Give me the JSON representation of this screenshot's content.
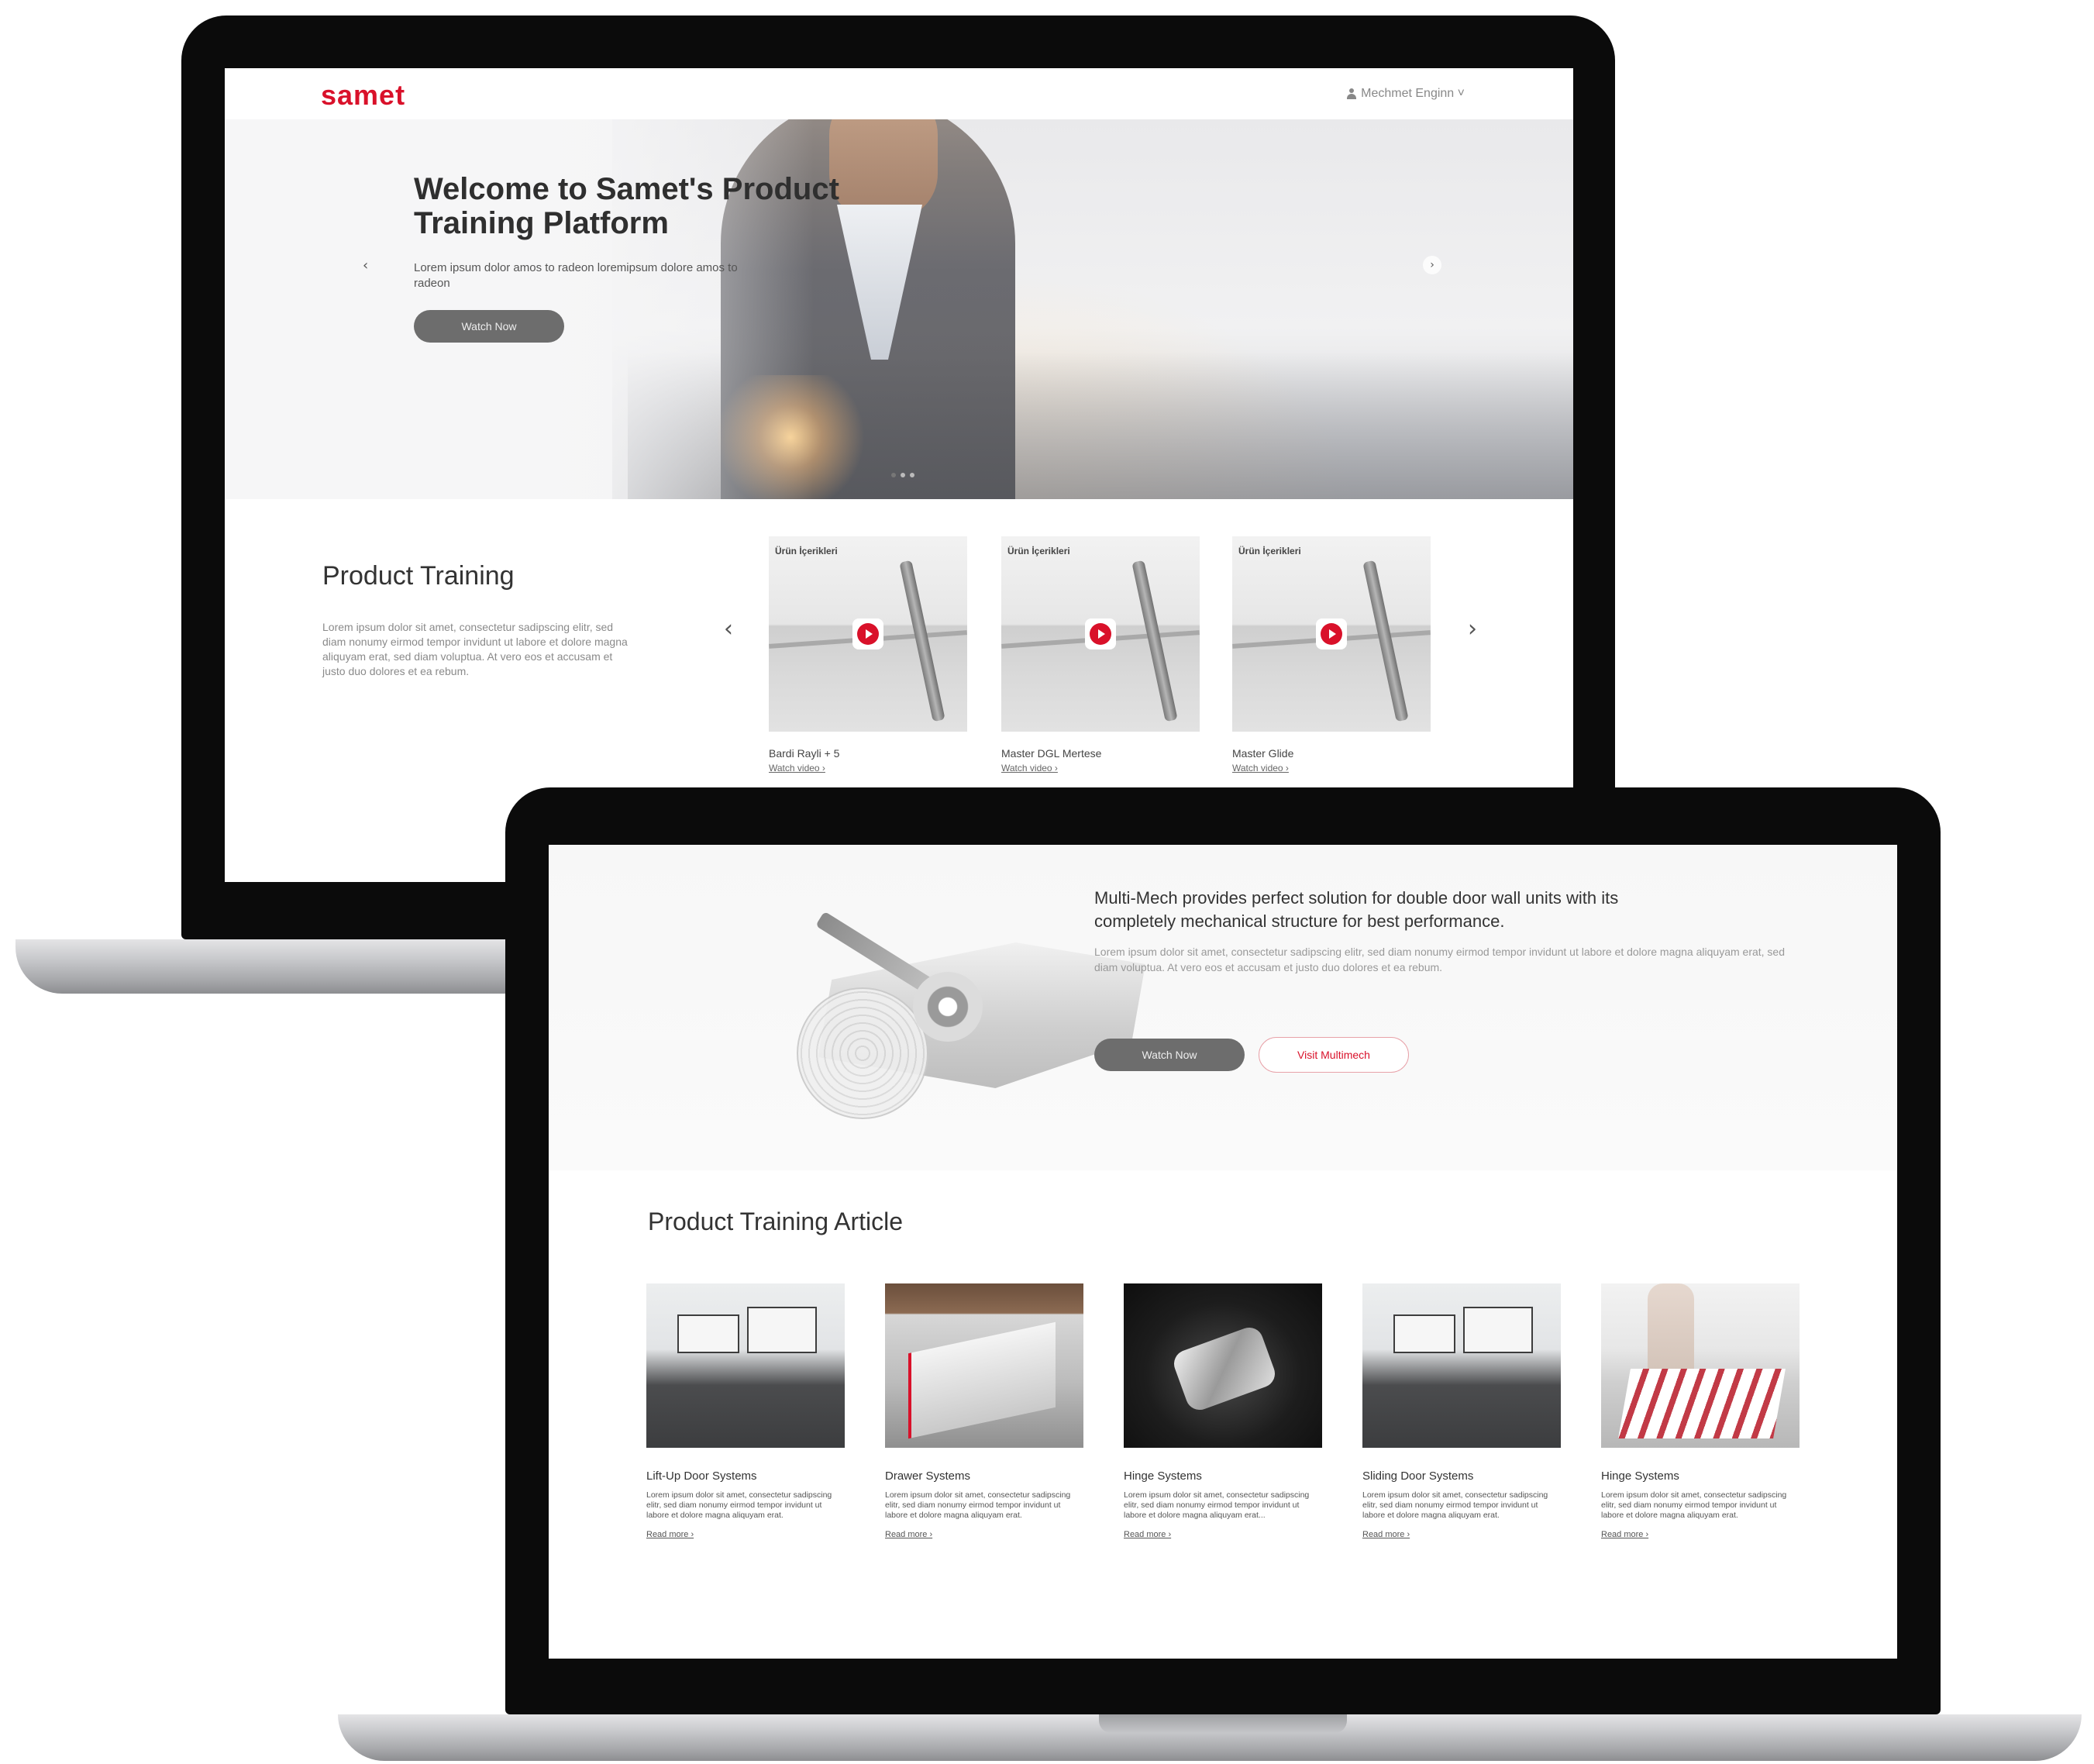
{
  "back": {
    "logo": "samet",
    "user_menu": "Mechmet Enginn ˅",
    "hero": {
      "title": "Welcome to Samet's Product Training Platform",
      "text": "Lorem ipsum dolor amos to radeon loremipsum dolore amos to radeon",
      "button": "Watch Now",
      "prev": "‹",
      "next": "›"
    },
    "product_training": {
      "title": "Product Training",
      "text": "Lorem ipsum dolor sit amet, consectetur sadipscing elitr, sed diam nonumy eirmod tempor invidunt ut labore et dolore magna aliquyam erat, sed diam voluptua. At vero eos et accusam et justo duo dolores et ea rebum.",
      "prev": "‹",
      "next": "›",
      "cards": [
        {
          "label": "Ürün İçerikleri",
          "title": "Bardi Rayli + 5",
          "link": "Watch video ›"
        },
        {
          "label": "Ürün İçerikleri",
          "title": "Master DGL Mertese",
          "link": "Watch video ›"
        },
        {
          "label": "Ürün İçerikleri",
          "title": "Master Glide",
          "link": "Watch video ›"
        }
      ]
    }
  },
  "front": {
    "multimech": {
      "heading": "Multi-Mech provides perfect solution for double door wall units with its completely mechanical structure for best performance.",
      "text": "Lorem ipsum dolor sit amet, consectetur sadipscing elitr, sed diam nonumy eirmod tempor invidunt ut labore et dolore magna aliquyam erat, sed diam voluptua. At vero eos et accusam et justo duo dolores et ea rebum.",
      "watch_button": "Watch Now",
      "visit_button": "Visit Multimech"
    },
    "articles": {
      "title": "Product Training Article",
      "items": [
        {
          "name": "Lift-Up Door Systems",
          "text": "Lorem ipsum dolor sit amet, consectetur sadipscing elitr, sed diam nonumy eirmod tempor invidunt ut labore et dolore magna aliquyam erat.",
          "link": "Read more ›"
        },
        {
          "name": "Drawer Systems",
          "text": "Lorem ipsum dolor sit amet, consectetur sadipscing elitr, sed diam nonumy eirmod tempor invidunt ut labore et dolore magna aliquyam erat.",
          "link": "Read more ›"
        },
        {
          "name": "Hinge Systems",
          "text": "Lorem ipsum dolor sit amet, consectetur sadipscing elitr, sed diam nonumy eirmod tempor invidunt ut labore et dolore magna aliquyam erat...",
          "link": "Read more ›"
        },
        {
          "name": "Sliding Door Systems",
          "text": "Lorem ipsum dolor sit amet, consectetur sadipscing elitr, sed diam nonumy eirmod tempor invidunt ut labore et dolore magna aliquyam erat.",
          "link": "Read more ›"
        },
        {
          "name": "Hinge Systems",
          "text": "Lorem ipsum dolor sit amet, consectetur sadipscing elitr, sed diam nonumy eirmod tempor invidunt ut labore et dolore magna aliquyam erat.",
          "link": "Read more ›"
        }
      ]
    }
  },
  "colors": {
    "brand": "#d9112a",
    "button_dark": "#6d6d6d",
    "frame": "#0b0b0b"
  },
  "icons": {
    "user": "user-icon",
    "play": "play-icon"
  }
}
